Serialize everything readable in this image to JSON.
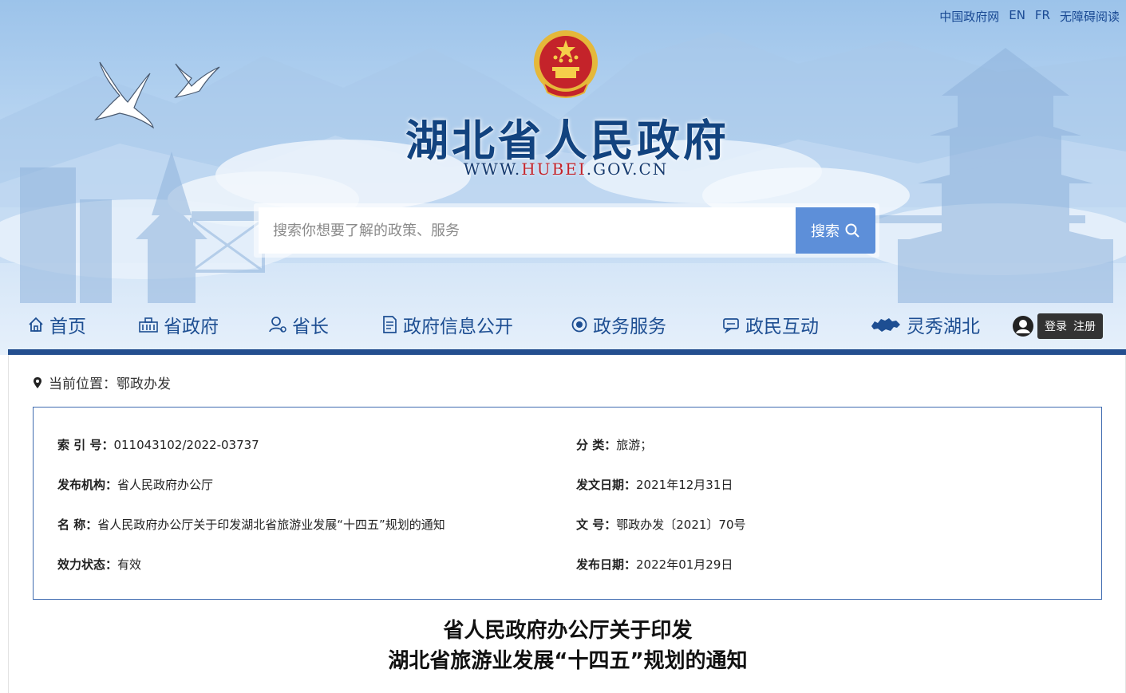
{
  "top_links": [
    "中国政府网",
    "EN",
    "FR",
    "无障碍阅读"
  ],
  "header": {
    "site_title": "湖北省人民政府",
    "url_prefix": "WWW.",
    "url_highlight": "HUBEI",
    "url_suffix": ".GOV.CN"
  },
  "search": {
    "placeholder": "搜索你想要了解的政策、服务",
    "button_label": "搜索"
  },
  "nav": [
    {
      "label": "首页",
      "icon": "home-icon"
    },
    {
      "label": "省政府",
      "icon": "building-icon"
    },
    {
      "label": "省长",
      "icon": "person-icon"
    },
    {
      "label": "政府信息公开",
      "icon": "document-icon"
    },
    {
      "label": "政务服务",
      "icon": "service-icon"
    },
    {
      "label": "政民互动",
      "icon": "chat-icon"
    },
    {
      "label": "灵秀湖北",
      "icon": "hubei-map-icon"
    }
  ],
  "user": {
    "login_label": "登录",
    "register_label": "注册"
  },
  "breadcrumb": {
    "label": "当前位置：",
    "current": "鄂政办发"
  },
  "meta": {
    "index_label": "索 引 号：",
    "index_value": "011043102/2022-03737",
    "category_label": "分 类：",
    "category_value": "旅游；",
    "publisher_label": "发布机构：",
    "publisher_value": "省人民政府办公厅",
    "issue_date_label": "发文日期：",
    "issue_date_value": "2021年12月31日",
    "name_label": "名 称：",
    "name_value": "省人民政府办公厅关于印发湖北省旅游业发展“十四五”规划的通知",
    "doc_no_label": "文 号：",
    "doc_no_value": "鄂政办发〔2021〕70号",
    "status_label": "效力状态：",
    "status_value": "有效",
    "publish_date_label": "发布日期：",
    "publish_date_value": "2022年01月29日"
  },
  "document": {
    "title_line1": "省人民政府办公厅关于印发",
    "title_line2": "湖北省旅游业发展“十四五”规划的通知"
  },
  "colors": {
    "brand_blue": "#12437f",
    "nav_bar": "#244f8f",
    "search_button": "#5d8fd9",
    "emblem_red": "#c4232a",
    "emblem_gold": "#e5b83a"
  }
}
